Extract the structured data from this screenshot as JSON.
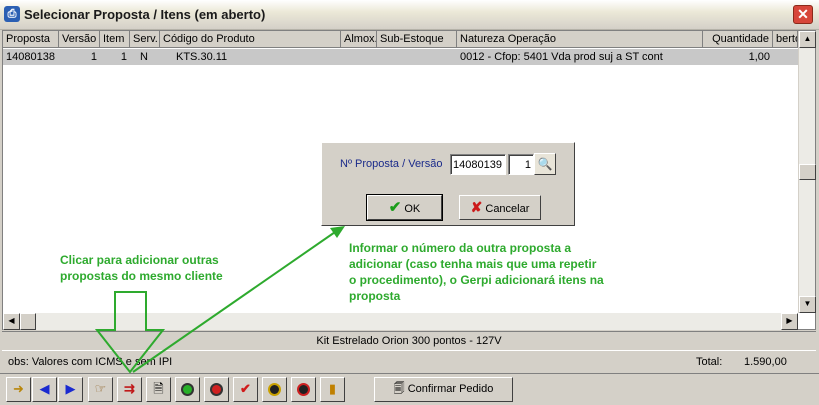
{
  "window": {
    "title": "Selecionar Proposta / Itens (em aberto)",
    "icon": "app-icon",
    "close_glyph": "✕"
  },
  "grid": {
    "columns": [
      "Proposta",
      "Versão",
      "Item",
      "Serv.",
      "Código do Produto",
      "Almox.",
      "Sub-Estoque",
      "Natureza Operação",
      "Quantidade",
      "berto"
    ],
    "row": {
      "proposta": "14080138",
      "versao": "1",
      "item": "1",
      "serv": "N",
      "codigo": "KTS.30.11",
      "almox": "",
      "subestoque": "",
      "natureza": "0012 - Cfop: 5401 Vda prod suj a ST cont",
      "quantidade": "1,00"
    }
  },
  "dialog": {
    "label": "Nº Proposta / Versão",
    "proposta_value": "14080139",
    "versao_value": "1",
    "ok_label": "OK",
    "cancel_label": "Cancelar"
  },
  "annotations": {
    "left_note": [
      "Clicar para adicionar outras",
      "propostas do mesmo cliente"
    ],
    "right_note": [
      "Informar o número da outra proposta a",
      "adicionar (caso tenha mais que uma repetir",
      "o procedimento), o Gerpi adicionará itens na",
      "proposta"
    ],
    "note_color": "#2eaa2e"
  },
  "product_bar": {
    "text": "Kit Estrelado Orion 300 pontos - 127V"
  },
  "status": {
    "obs": "obs: Valores com ICMS e sem IPI",
    "total_label": "Total:",
    "total_value": "1.590,00"
  },
  "toolbar": {
    "confirm_label": "Confirmar Pedido",
    "buttons": [
      "exit-icon",
      "arrow-left-icon",
      "arrow-right-icon",
      "hand-pointer-icon",
      "add-proposal-icon",
      "document-icon",
      "green-light-icon",
      "red-light-icon",
      "checkmark-icon",
      "black-dot-icon",
      "record-icon",
      "door-exit-icon"
    ]
  }
}
